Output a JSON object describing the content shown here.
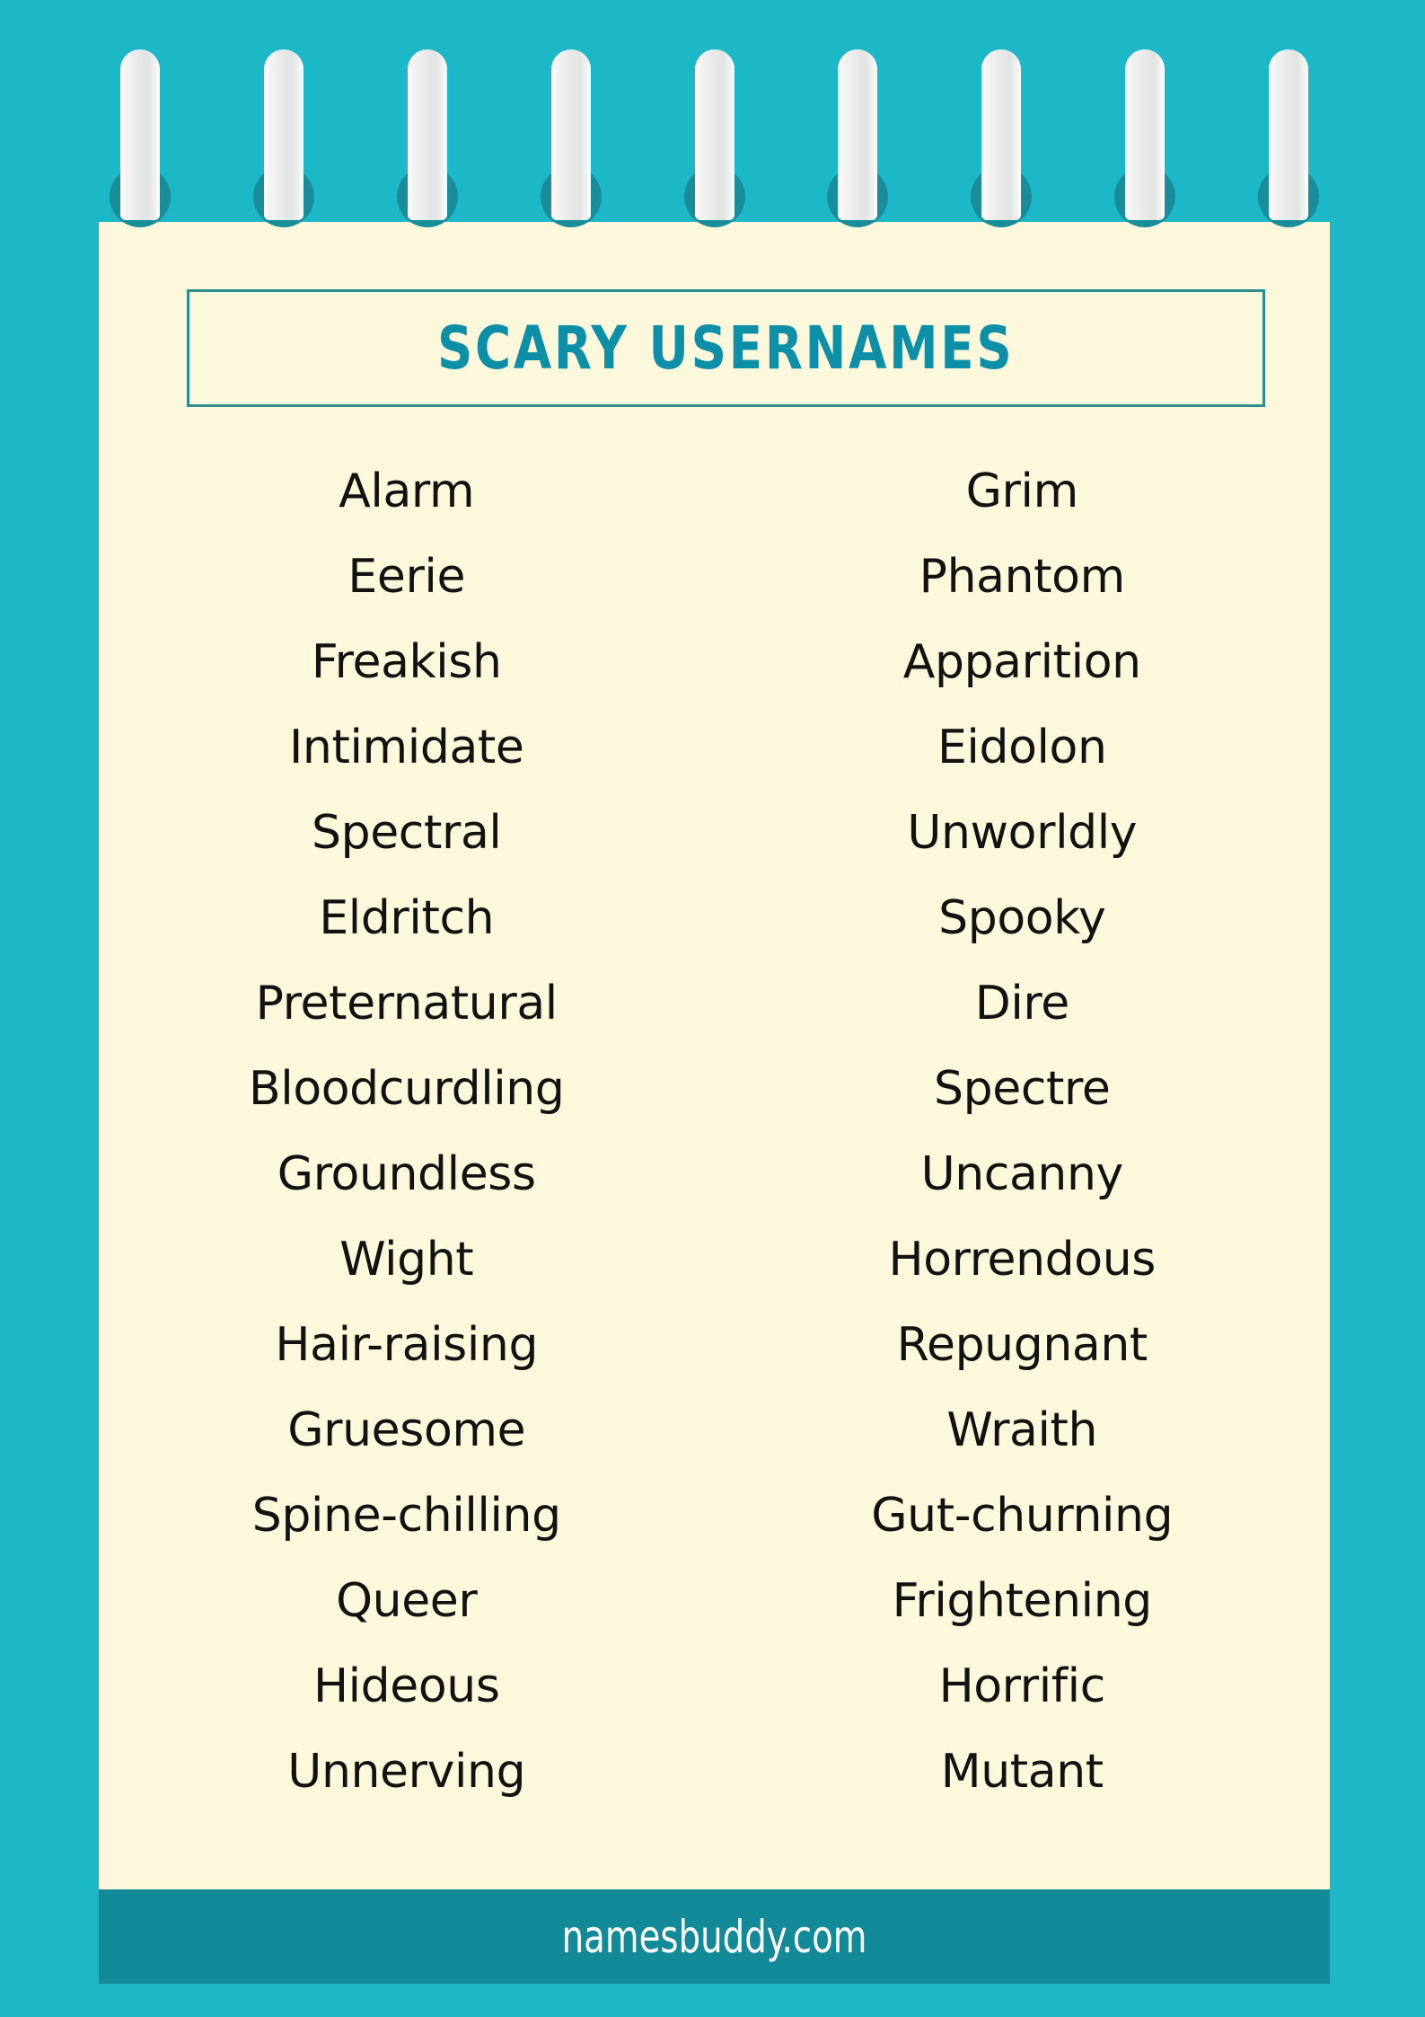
{
  "poster": {
    "title": "SCARY USERNAMES",
    "footer": "namesbuddy.com",
    "colors": {
      "background_teal": "#1CB8C8",
      "paper_cream": "#FCF8DC",
      "title_teal": "#0E8FA8",
      "title_border": "#2F8D8D",
      "footer_band": "#138A98",
      "ring_hole": "#1A8D9B",
      "ring_metal": "#E9EAEA",
      "word_text": "#121212"
    },
    "binding": {
      "ring_count": 9
    }
  },
  "list": {
    "left_column": [
      "Alarm",
      "Eerie",
      "Freakish",
      "Intimidate",
      "Spectral",
      "Eldritch",
      "Preternatural",
      "Bloodcurdling",
      "Groundless",
      "Wight",
      "Hair-raising",
      "Gruesome",
      "Spine-chilling",
      "Queer",
      "Hideous",
      "Unnerving"
    ],
    "right_column": [
      "Grim",
      "Phantom",
      "Apparition",
      "Eidolon",
      "Unworldly",
      "Spooky",
      "Dire",
      "Spectre",
      "Uncanny",
      "Horrendous",
      "Repugnant",
      "Wraith",
      "Gut-churning",
      "Frightening",
      "Horrific",
      "Mutant"
    ]
  }
}
